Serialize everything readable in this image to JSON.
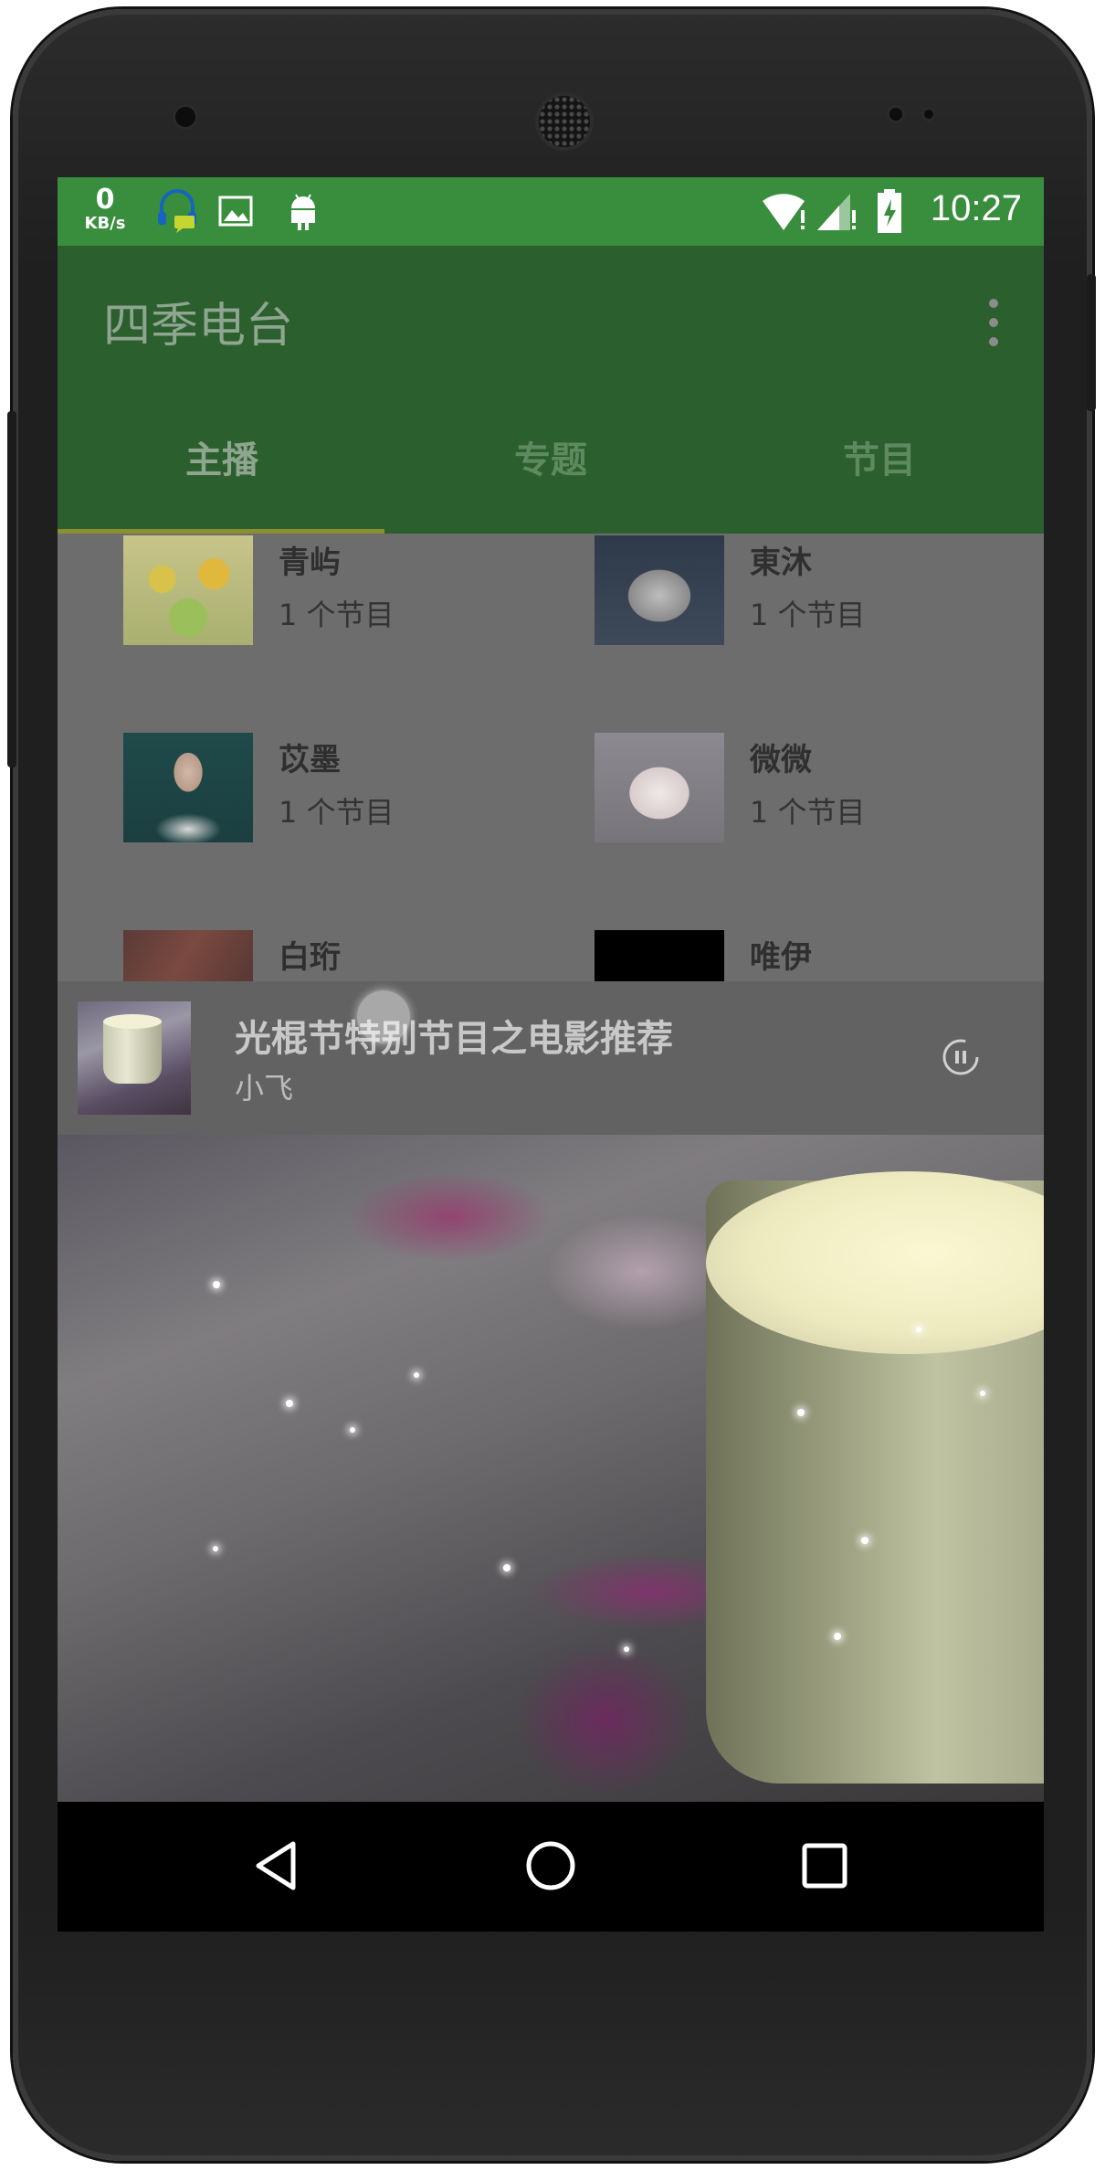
{
  "status_bar": {
    "net_speed_value": "0",
    "net_speed_unit": "KB/s",
    "time": "10:27"
  },
  "toolbar": {
    "title": "四季电台"
  },
  "tabs": [
    {
      "label": "主播",
      "active": true
    },
    {
      "label": "专题",
      "active": false
    },
    {
      "label": "节目",
      "active": false
    }
  ],
  "anchors": [
    {
      "name": "青屿",
      "count": "1 个节目"
    },
    {
      "name": "東沐",
      "count": "1 个节目"
    },
    {
      "name": "苡墨",
      "count": "1 个节目"
    },
    {
      "name": "微微",
      "count": "1 个节目"
    },
    {
      "name": "白珩",
      "count": ""
    },
    {
      "name": "唯伊",
      "count": ""
    }
  ],
  "now_playing": {
    "title": "光棍节特别节目之电影推荐",
    "host": "小飞",
    "state": "playing"
  },
  "colors": {
    "status_bar": "#388e3c",
    "toolbar": "#2b5f2d",
    "tab_indicator": "#8a8f2f"
  }
}
